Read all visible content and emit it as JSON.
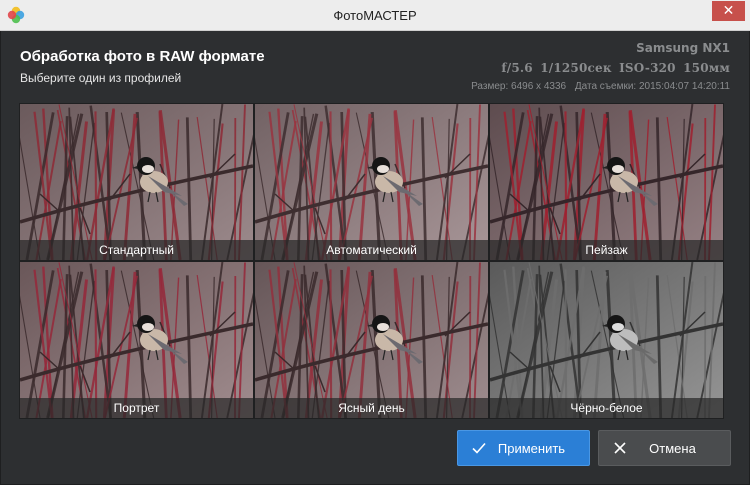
{
  "window": {
    "title": "ФотоМАСТЕР",
    "close_glyph": "✕"
  },
  "header": {
    "title": "Обработка фото в RAW формате",
    "subtitle": "Выберите один из профилей"
  },
  "camera": {
    "model": "Samsung NX1",
    "exif": "f/5.6  1/1250сек  ISO-320  150мм",
    "size": "Размер: 6496 x 4336",
    "date": "Дата съемки: 2015:04:07 14:20:11"
  },
  "profiles": [
    {
      "label": "Стандартный",
      "style": "standard"
    },
    {
      "label": "Автоматический",
      "style": "auto"
    },
    {
      "label": "Пейзаж",
      "style": "landscape"
    },
    {
      "label": "Портрет",
      "style": "portrait"
    },
    {
      "label": "Ясный день",
      "style": "clear"
    },
    {
      "label": "Чёрно-белое",
      "style": "bw"
    }
  ],
  "buttons": {
    "apply": "Применить",
    "cancel": "Отмена"
  },
  "colors": {
    "accent": "#2b7fd6",
    "close": "#c7504b"
  }
}
